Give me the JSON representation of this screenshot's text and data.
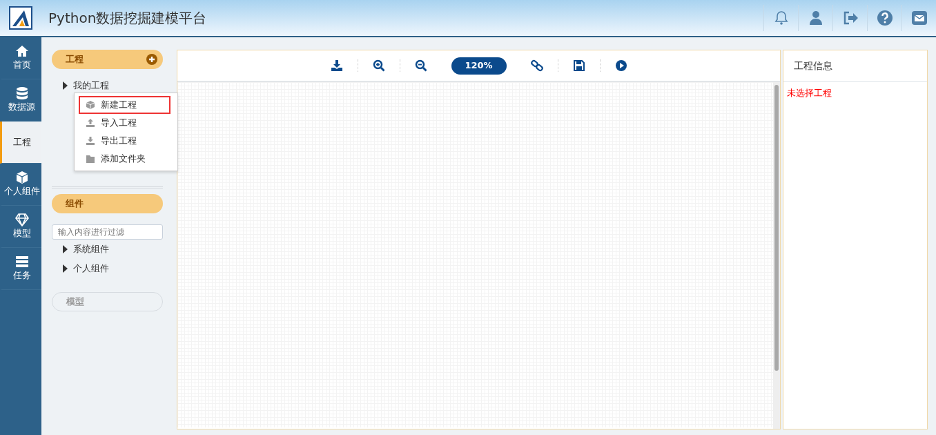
{
  "header": {
    "title": "Python数据挖掘建模平台"
  },
  "nav": [
    {
      "label": "首页",
      "selected": false
    },
    {
      "label": "数据源",
      "selected": false
    },
    {
      "label": "工程",
      "selected": true
    },
    {
      "label": "个人组件",
      "selected": false
    },
    {
      "label": "模型",
      "selected": false
    },
    {
      "label": "任务",
      "selected": false
    }
  ],
  "project_section": {
    "title": "工程",
    "tree": [
      {
        "label": "我的工程",
        "expanded": false
      }
    ]
  },
  "context_menu": [
    {
      "label": "新建工程",
      "highlighted": true
    },
    {
      "label": "导入工程",
      "highlighted": false
    },
    {
      "label": "导出工程",
      "highlighted": false
    },
    {
      "label": "添加文件夹",
      "highlighted": false
    }
  ],
  "component_section": {
    "title": "组件",
    "filter_placeholder": "输入内容进行过滤",
    "tree": [
      {
        "label": "系统组件",
        "expanded": false
      },
      {
        "label": "个人组件",
        "expanded": false
      }
    ]
  },
  "model_section": {
    "title": "模型",
    "disabled": true
  },
  "toolbar": {
    "zoom": "120%"
  },
  "info_panel": {
    "title": "工程信息",
    "message": "未选择工程"
  }
}
